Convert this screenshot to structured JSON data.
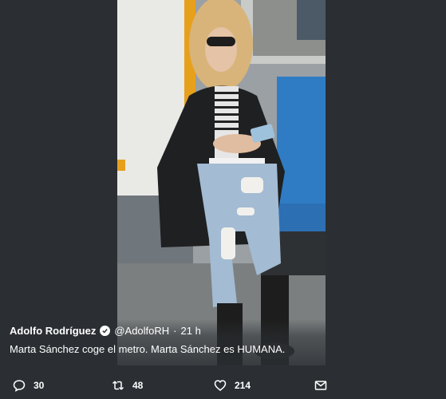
{
  "tweet": {
    "author_name": "Adolfo Rodríguez",
    "handle": "@AdolfoRH",
    "separator": "·",
    "time": "21 h",
    "text": "Marta Sánchez coge el metro. Marta Sánchez es HUMANA."
  },
  "actions": {
    "replies": "30",
    "retweets": "48",
    "likes": "214"
  },
  "icons": {
    "verified": "verified-badge-icon",
    "reply": "reply-icon",
    "retweet": "retweet-icon",
    "like": "heart-icon",
    "message": "envelope-icon"
  },
  "colors": {
    "background": "#2b2f33",
    "text": "#ffffff"
  }
}
